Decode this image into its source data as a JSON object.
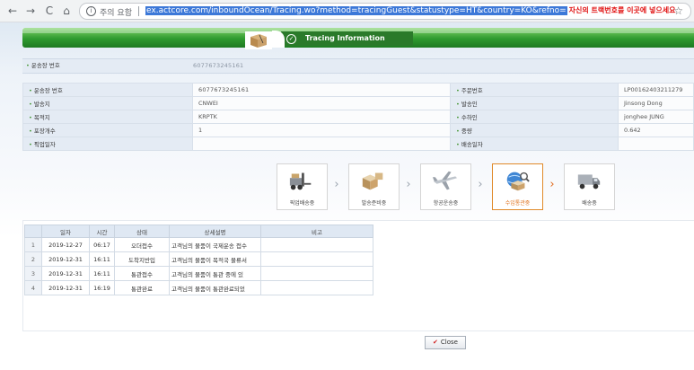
{
  "browser": {
    "back_icon": "←",
    "forward_icon": "→",
    "reload_icon": "C",
    "home_icon": "⌂",
    "security_label": "주의 요함",
    "url": "ex.actcore.com/inboundOcean/Tracing.wo?method=tracingGuest&statustype=HT&country=KO&refno=",
    "url_annotation": "자신의 트랙번호를 이곳에 넣으세요",
    "star_icon": "☆"
  },
  "header": {
    "title": "Tracing Information"
  },
  "summary": {
    "label": "운송장 번호",
    "value": "6077673245161"
  },
  "info": {
    "rows": [
      {
        "l1": "운송장 번호",
        "v1": "6077673245161",
        "l2": "주문번호",
        "v2": "LP00162403211279"
      },
      {
        "l1": "발송지",
        "v1": "CNWEI",
        "l2": "발송인",
        "v2": "Jinsong Dong"
      },
      {
        "l1": "목적지",
        "v1": "KRPTK",
        "l2": "수하인",
        "v2": "jonghee JUNG"
      },
      {
        "l1": "포장개수",
        "v1": "1",
        "l2": "중량",
        "v2": "0.642"
      },
      {
        "l1": "픽업일자",
        "v1": "",
        "l2": "배송일자",
        "v2": ""
      }
    ]
  },
  "steps": [
    {
      "label": "픽업배송중",
      "icon": "forklift-icon",
      "active": false
    },
    {
      "label": "발송준비중",
      "icon": "boxes-icon",
      "active": false
    },
    {
      "label": "항공운송중",
      "icon": "airplane-icon",
      "active": false
    },
    {
      "label": "수입통관중",
      "icon": "customs-globe-icon",
      "active": true
    },
    {
      "label": "배송중",
      "icon": "delivery-truck-icon",
      "active": false
    }
  ],
  "history": {
    "headers": [
      "일자",
      "시간",
      "상태",
      "상세설명",
      "비고"
    ],
    "rows": [
      {
        "no": "1",
        "date": "2019-12-27",
        "time": "06:17",
        "status": "오더접수",
        "desc": "고객님의 물품이 국제운송 접수",
        "note": ""
      },
      {
        "no": "2",
        "date": "2019-12-31",
        "time": "16:11",
        "status": "도착지반입",
        "desc": "고객님의 물품이 목적국 물류서",
        "note": ""
      },
      {
        "no": "3",
        "date": "2019-12-31",
        "time": "16:11",
        "status": "통관접수",
        "desc": "고객님의 물품이 통관 중에 있",
        "note": ""
      },
      {
        "no": "4",
        "date": "2019-12-31",
        "time": "16:19",
        "status": "통관완료",
        "desc": "고객님의 물품이 통관완료되었",
        "note": ""
      }
    ]
  },
  "close_label": "Close",
  "colors": {
    "accent_green": "#2f9a2f",
    "active_orange": "#e06a1a",
    "annotation_red": "#e01010"
  }
}
